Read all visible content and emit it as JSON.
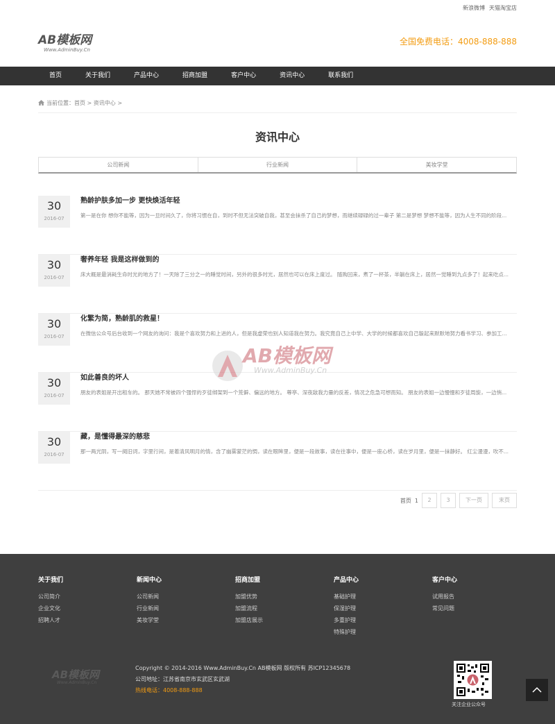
{
  "header": {
    "top_links": [
      "新浪微博",
      "天猫淘宝店"
    ],
    "logo_text": "AB模板网",
    "logo_sub": "Www.AdminBuy.Cn",
    "hotline": "全国免费电话：4008-888-888"
  },
  "nav": {
    "items": [
      {
        "label": "首页"
      },
      {
        "label": "关于我们"
      },
      {
        "label": "产品中心"
      },
      {
        "label": "招商加盟"
      },
      {
        "label": "客户中心"
      },
      {
        "label": "资讯中心"
      },
      {
        "label": "联系我们"
      }
    ]
  },
  "breadcrumb": {
    "text": "当前位置：首页 > 资讯中心 >"
  },
  "page_title": "资讯中心",
  "subtabs": [
    {
      "label": "公司新闻"
    },
    {
      "label": "行业新闻"
    },
    {
      "label": "美妆学堂"
    }
  ],
  "news": [
    {
      "day": "30",
      "ym": "2016-07",
      "title": "熟龄护肤多加一步 更快焕活年轻",
      "desc": "第一是在你 想你不能等，因为一旦时间久了，你将习惯在自，到时不但无法突破自我，甚至会抹杀了自己的梦想，而继续碌碌的过一辈子 第二是梦想 梦想不能等，因为人生不同的阶段..."
    },
    {
      "day": "30",
      "ym": "2016-07",
      "title": "奢养年轻 我是这样做到的",
      "desc": "床大概是最消耗生命时光的地方了！一天除了三分之一的睡觉时间，另外的很多时光，居然也可以在床上度过。 随购回来，煮了一杯茶，半躺在床上，居然一觉睡到九点多了！起来吃点..."
    },
    {
      "day": "30",
      "ym": "2016-07",
      "title": "化繁为简，熟龄肌的救星！",
      "desc": "在微信公众号后台收到一个网友的询问：我是个喜欢努力和上进的人，但是我虚荣也别人知道我在努力。我究竟自己上中学、大学的时候都喜欢自己躲起来默默地努力看书学习、参加工..."
    },
    {
      "day": "30",
      "ym": "2016-07",
      "title": "如此善良的坏人",
      "desc": "朋友的表姐是开出租车的。 那天她不常被四个强悍的歹徒绑架到一个荒僻、偏远的地方。 尊亭、深夜敌我力量的反差，情况之危急可想而知。 朋友的表姐一边慢慢和歹徒周旋，一边悄..."
    },
    {
      "day": "30",
      "ym": "2016-07",
      "title": "藏，是懂得最深的慈悲",
      "desc": "那一两光阴，写一阕旧词，字里行间，是着清风明月的情，含了幽雾蒙茫的惆，读在眼眸里，便是一段故事，读在往事中，便是一座心桥，读在岁月里，便是一抹静好。 红尘漫漫，吹不..."
    }
  ],
  "pager": {
    "label": "首页",
    "page_info": "1",
    "pages": [
      "2",
      "3"
    ],
    "next": "下一页",
    "last": "末页"
  },
  "watermark": {
    "text": "AB模板网",
    "sub": "Www.AdminBuy.Cn"
  },
  "footer": {
    "columns": [
      {
        "title": "关于我们",
        "items": [
          "公司简介",
          "企业文化",
          "招聘人才"
        ]
      },
      {
        "title": "新闻中心",
        "items": [
          "公司新闻",
          "行业新闻",
          "美妆学堂"
        ]
      },
      {
        "title": "招商加盟",
        "items": [
          "加盟优势",
          "加盟流程",
          "加盟店展示"
        ]
      },
      {
        "title": "产品中心",
        "items": [
          "基础护理",
          "保湿护理",
          "多重护理",
          "特殊护理"
        ]
      },
      {
        "title": "客户中心",
        "items": [
          "试用报告",
          "常见问题"
        ]
      }
    ],
    "logo_text": "AB模板网",
    "logo_sub": "Www.AdminBuy.Cn",
    "copyright": "Copyright © 2014-2016 Www.AdminBuy.Cn AB模板网 版权所有 苏ICP12345678",
    "address": "公司地址：江苏省南京市玄武区玄武湖",
    "tel": "热线电话：4008-888-888",
    "qr_caption": "关注企业公众号"
  },
  "colors": {
    "nav_bg": "#333333",
    "accent": "#f39c12",
    "footer_bg": "#3f3f3f"
  }
}
